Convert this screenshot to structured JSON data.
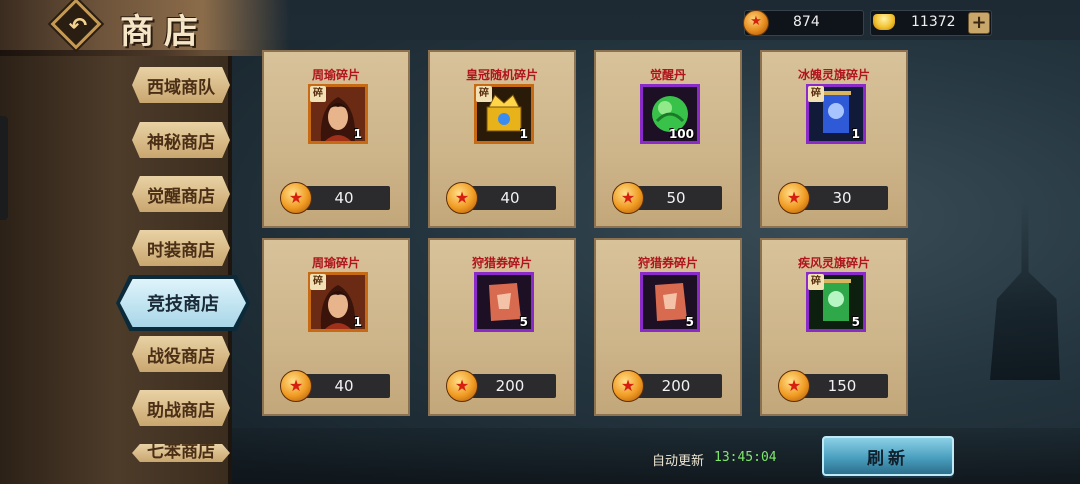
{
  "header": {
    "title": "商店"
  },
  "currency": {
    "coins": "874",
    "ingots": "11372"
  },
  "sidebar": {
    "tabs": [
      {
        "label": "西域商队"
      },
      {
        "label": "神秘商店"
      },
      {
        "label": "觉醒商店"
      },
      {
        "label": "时装商店"
      },
      {
        "label": "竞技商店",
        "active": true
      },
      {
        "label": "战役商店"
      },
      {
        "label": "助战商店"
      },
      {
        "label": "七苯商店"
      }
    ]
  },
  "items": [
    {
      "name": "周瑜碎片",
      "qty": "1",
      "price": "40",
      "frame": "orange",
      "icon": "hero-portrait-icon",
      "fragment": "碎"
    },
    {
      "name": "皇冠随机碎片",
      "qty": "1",
      "price": "40",
      "frame": "orange",
      "icon": "crown-chest-icon",
      "fragment": "碎"
    },
    {
      "name": "觉醒丹",
      "qty": "100",
      "price": "50",
      "frame": "purple",
      "icon": "green-pill-icon",
      "fragment": ""
    },
    {
      "name": "冰魄灵旗碎片",
      "qty": "1",
      "price": "30",
      "frame": "purple",
      "icon": "blue-banner-icon",
      "fragment": "碎"
    },
    {
      "name": "周瑜碎片",
      "qty": "1",
      "price": "40",
      "frame": "orange",
      "icon": "hero-portrait-icon",
      "fragment": "碎"
    },
    {
      "name": "狩猎券碎片",
      "qty": "5",
      "price": "200",
      "frame": "purple",
      "icon": "hunt-ticket-icon",
      "fragment": ""
    },
    {
      "name": "狩猎券碎片",
      "qty": "5",
      "price": "200",
      "frame": "purple",
      "icon": "hunt-ticket-icon",
      "fragment": ""
    },
    {
      "name": "疾风灵旗碎片",
      "qty": "5",
      "price": "150",
      "frame": "purple",
      "icon": "green-banner-icon",
      "fragment": "碎"
    }
  ],
  "footer": {
    "auto_refresh_label": "自动更新",
    "auto_refresh_time": "13:45:04",
    "refresh_button": "刷新"
  }
}
